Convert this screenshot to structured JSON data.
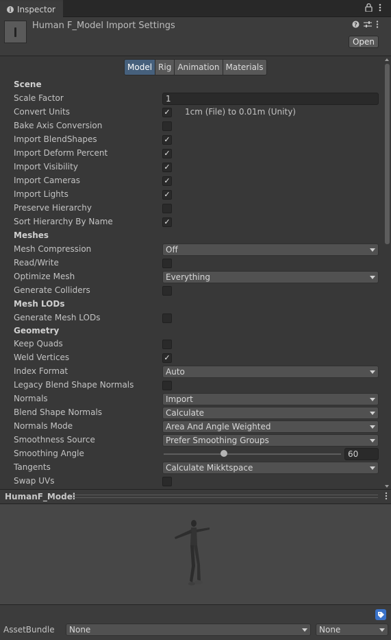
{
  "window": {
    "tab_label": "Inspector",
    "tab_icon": "info-icon"
  },
  "header": {
    "title": "Human F_Model Import Settings",
    "open_label": "Open",
    "icons": [
      "help-icon",
      "preset-sliders-icon",
      "kebab-menu-icon"
    ]
  },
  "tabs": [
    {
      "label": "Model",
      "active": true
    },
    {
      "label": "Rig",
      "active": false
    },
    {
      "label": "Animation",
      "active": false
    },
    {
      "label": "Materials",
      "active": false
    }
  ],
  "rows": {
    "scene_header": "Scene",
    "scale_factor": {
      "label": "Scale Factor",
      "value": "1"
    },
    "convert_units": {
      "label": "Convert Units",
      "checked": true,
      "note": "1cm (File) to 0.01m (Unity)"
    },
    "bake_axis": {
      "label": "Bake Axis Conversion",
      "checked": false
    },
    "import_blendshapes": {
      "label": "Import BlendShapes",
      "checked": true
    },
    "import_deform": {
      "label": "Import Deform Percent",
      "checked": true
    },
    "import_visibility": {
      "label": "Import Visibility",
      "checked": true
    },
    "import_cameras": {
      "label": "Import Cameras",
      "checked": true
    },
    "import_lights": {
      "label": "Import Lights",
      "checked": true
    },
    "preserve_hierarchy": {
      "label": "Preserve Hierarchy",
      "checked": false
    },
    "sort_hierarchy": {
      "label": "Sort Hierarchy By Name",
      "checked": true
    },
    "meshes_header": "Meshes",
    "mesh_compression": {
      "label": "Mesh Compression",
      "value": "Off"
    },
    "read_write": {
      "label": "Read/Write",
      "checked": false
    },
    "optimize_mesh": {
      "label": "Optimize Mesh",
      "value": "Everything"
    },
    "generate_colliders": {
      "label": "Generate Colliders",
      "checked": false
    },
    "mesh_lods_header": "Mesh LODs",
    "generate_mesh_lods": {
      "label": "Generate Mesh LODs",
      "checked": false
    },
    "geometry_header": "Geometry",
    "keep_quads": {
      "label": "Keep Quads",
      "checked": false
    },
    "weld_vertices": {
      "label": "Weld Vertices",
      "checked": true
    },
    "index_format": {
      "label": "Index Format",
      "value": "Auto"
    },
    "legacy_blend": {
      "label": "Legacy Blend Shape Normals",
      "checked": false
    },
    "normals": {
      "label": "Normals",
      "value": "Import"
    },
    "blend_shape_normals": {
      "label": "Blend Shape Normals",
      "value": "Calculate"
    },
    "normals_mode": {
      "label": "Normals Mode",
      "value": "Area And Angle Weighted"
    },
    "smoothness_source": {
      "label": "Smoothness Source",
      "value": "Prefer Smoothing Groups"
    },
    "smoothing_angle": {
      "label": "Smoothing Angle",
      "value": "60",
      "min": 0,
      "max": 180
    },
    "tangents": {
      "label": "Tangents",
      "value": "Calculate Mikktspace"
    },
    "swap_uvs": {
      "label": "Swap UVs",
      "checked": false
    }
  },
  "preview": {
    "title": "HumanF_Model"
  },
  "asset_bundle": {
    "label": "AssetBundle",
    "name_value": "None",
    "variant_value": "None"
  },
  "colors": {
    "active_tab": "#46607c",
    "background": "#383838",
    "tag_icon": "#3a72c8"
  }
}
